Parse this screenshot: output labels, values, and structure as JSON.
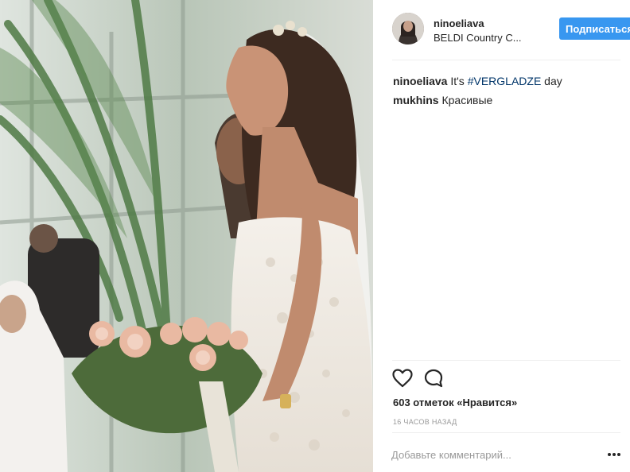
{
  "post": {
    "author": "ninoeliava",
    "location": "BELDI Country C...",
    "follow_label": "Подписаться"
  },
  "comments": [
    {
      "user": "ninoeliava",
      "pre": "It's ",
      "hashtag": "#VERGLADZE",
      "post": " day"
    },
    {
      "user": "mukhins",
      "pre": "Красивые",
      "hashtag": "",
      "post": ""
    }
  ],
  "likes": "603 отметок «Нравится»",
  "time_ago": "16 ЧАСОВ НАЗАД",
  "add_comment_placeholder": "Добавьте комментарий...",
  "icons": {
    "like": "heart-icon",
    "comment": "comment-icon",
    "more": "more-options-icon"
  },
  "colors": {
    "follow_button": "#3897f0",
    "hashtag": "#003569",
    "muted": "#999999"
  }
}
